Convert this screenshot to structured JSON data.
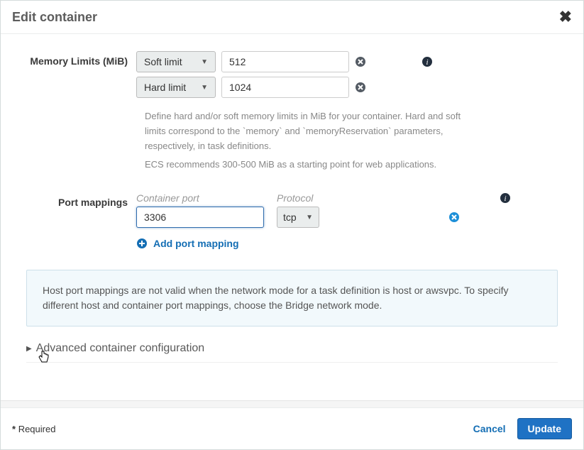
{
  "header": {
    "title": "Edit container"
  },
  "memory": {
    "label": "Memory Limits (MiB)",
    "soft_select": "Soft limit",
    "soft_value": "512",
    "hard_select": "Hard limit",
    "hard_value": "1024",
    "help_line1": "Define hard and/or soft memory limits in MiB for your container. Hard and soft limits correspond to the `memory` and `memoryReservation` parameters, respectively, in task definitions.",
    "help_line2": "ECS recommends 300-500 MiB as a starting point for web applications."
  },
  "ports": {
    "label": "Port mappings",
    "col_container": "Container port",
    "col_protocol": "Protocol",
    "container_port_value": "3306",
    "protocol_value": "tcp",
    "add_label": "Add port mapping"
  },
  "infobox": {
    "text": "Host port mappings are not valid when the network mode for a task definition is host or awsvpc. To specify different host and container port mappings, choose the Bridge network mode."
  },
  "advanced": {
    "label": "Advanced container configuration"
  },
  "footer": {
    "required": "Required",
    "cancel": "Cancel",
    "update": "Update"
  },
  "colors": {
    "primary_blue": "#146eb4",
    "button_blue": "#1f72c4",
    "info_bg": "#f2f9fc"
  }
}
